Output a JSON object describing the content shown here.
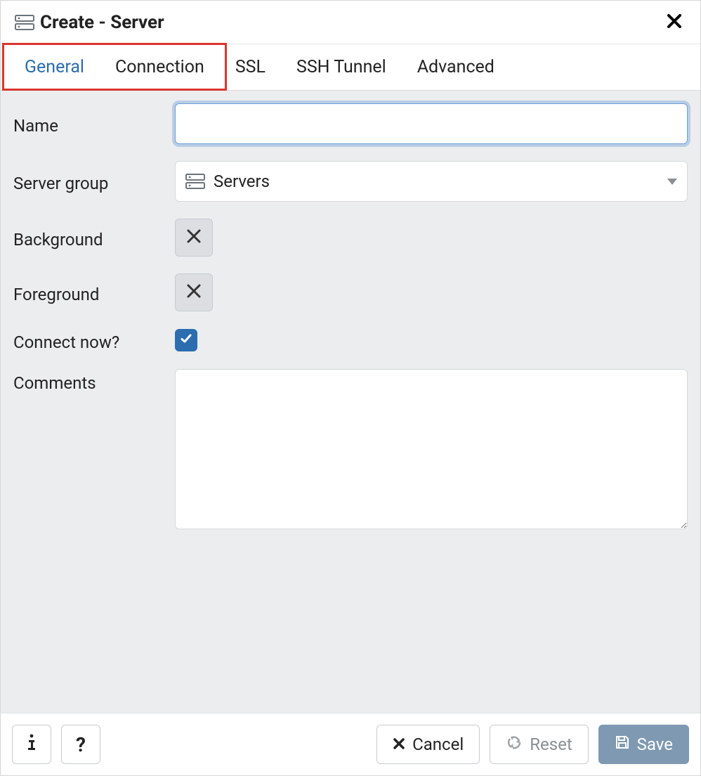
{
  "dialog": {
    "title": "Create - Server"
  },
  "tabs": {
    "general": "General",
    "connection": "Connection",
    "ssl": "SSL",
    "ssh": "SSH Tunnel",
    "advanced": "Advanced",
    "active": "general"
  },
  "form": {
    "name_label": "Name",
    "name_value": "",
    "server_group_label": "Server group",
    "server_group_value": "Servers",
    "background_label": "Background",
    "foreground_label": "Foreground",
    "connect_now_label": "Connect now?",
    "connect_now_checked": true,
    "comments_label": "Comments",
    "comments_value": ""
  },
  "footer": {
    "cancel": "Cancel",
    "reset": "Reset",
    "save": "Save"
  }
}
